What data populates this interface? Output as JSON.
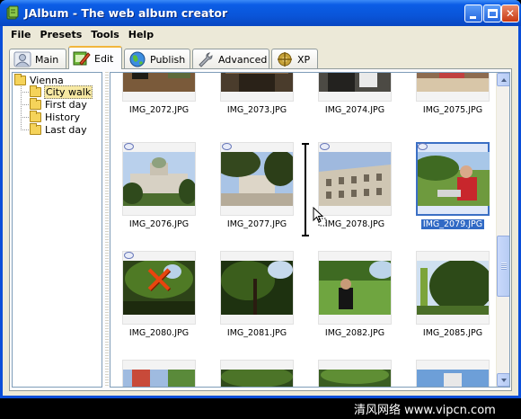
{
  "window": {
    "title": "JAlbum - The web album creator"
  },
  "menu": [
    "File",
    "Presets",
    "Tools",
    "Help"
  ],
  "tabs": [
    {
      "label": "Main",
      "icon": "user-icon",
      "active": false
    },
    {
      "label": "Edit",
      "icon": "edit-icon",
      "active": true
    },
    {
      "label": "Publish",
      "icon": "globe-icon",
      "active": false
    },
    {
      "label": "Advanced",
      "icon": "wrench-icon",
      "active": false
    },
    {
      "label": "XP",
      "icon": "xp-icon",
      "active": false
    }
  ],
  "tree": {
    "root": "Vienna",
    "children": [
      "City walk",
      "First day",
      "History",
      "Last day"
    ],
    "selected": "City walk"
  },
  "gallery": {
    "rows": [
      [
        "IMG_2072.JPG",
        "IMG_2073.JPG",
        "IMG_2074.JPG",
        "IMG_2075.JPG"
      ],
      [
        "IMG_2076.JPG",
        "IMG_2077.JPG",
        "IMG_2078.JPG",
        "IMG_2079.JPG"
      ],
      [
        "IMG_2080.JPG",
        "IMG_2081.JPG",
        "IMG_2082.JPG",
        "IMG_2085.JPG"
      ]
    ],
    "selected": "IMG_2079.JPG",
    "excluded": "IMG_2080.JPG"
  },
  "watermark": "清风网络 www.vipcn.com",
  "colors": {
    "titlebar": "#0a55d9",
    "selection": "#316ac5",
    "tab_highlight": "#f1b63c",
    "exclude_mark": "#e8450e"
  }
}
